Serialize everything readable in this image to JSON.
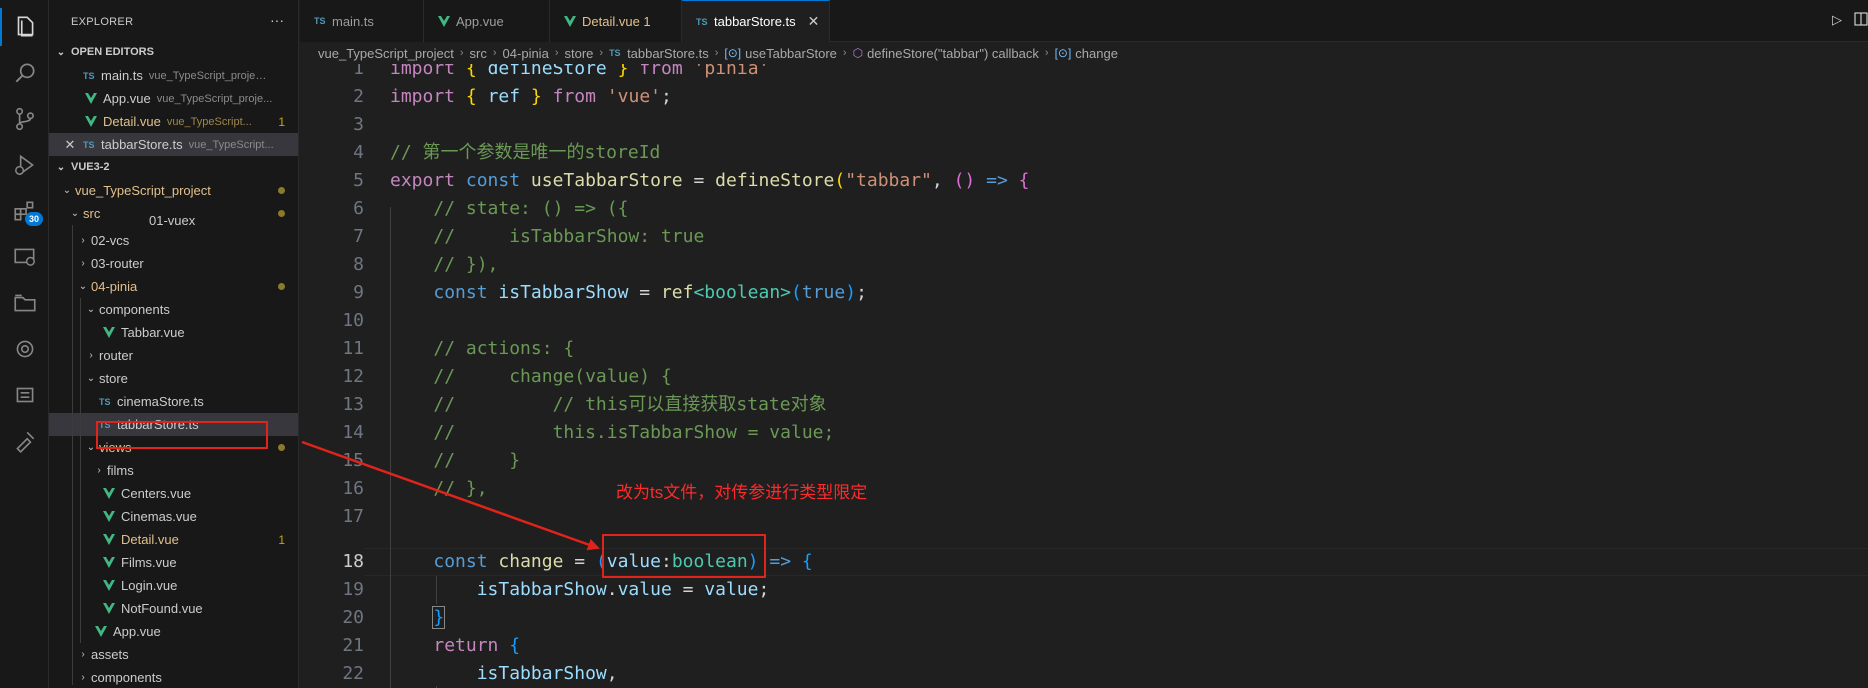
{
  "sidebar": {
    "title": "EXPLORER",
    "open_editors": {
      "header": "OPEN EDITORS",
      "items": [
        {
          "icon": "TS",
          "name": "main.ts",
          "desc": "vue_TypeScript_project..."
        },
        {
          "icon": "vue",
          "name": "App.vue",
          "desc": "vue_TypeScript_proje..."
        },
        {
          "icon": "vue",
          "name": "Detail.vue",
          "desc": "vue_TypeScript...",
          "count": "1"
        },
        {
          "icon": "TS",
          "name": "tabbarStore.ts",
          "desc": "vue_TypeScript..."
        }
      ]
    },
    "workspace": {
      "header": "VUE3-2",
      "project": "vue_TypeScript_project",
      "tree": [
        {
          "label": "src",
          "color": "orange"
        },
        {
          "label": "01-vuex"
        },
        {
          "label": "02-vcs"
        },
        {
          "label": "03-router"
        },
        {
          "label": "04-pinia"
        },
        {
          "label": "components"
        },
        {
          "label": "Tabbar.vue"
        },
        {
          "label": "router"
        },
        {
          "label": "store"
        },
        {
          "label": "cinemaStore.ts"
        },
        {
          "label": "tabbarStore.ts"
        },
        {
          "label": "views"
        },
        {
          "label": "films"
        },
        {
          "label": "Centers.vue"
        },
        {
          "label": "Cinemas.vue"
        },
        {
          "label": "Detail.vue",
          "count": "1"
        },
        {
          "label": "Films.vue"
        },
        {
          "label": "Login.vue"
        },
        {
          "label": "NotFound.vue"
        },
        {
          "label": "App.vue"
        },
        {
          "label": "assets"
        },
        {
          "label": "components"
        }
      ]
    }
  },
  "activity": {
    "extensions_badge": "30"
  },
  "tabs": [
    {
      "label": "main.ts",
      "icon": "TS"
    },
    {
      "label": "App.vue",
      "icon": "vue"
    },
    {
      "label": "Detail.vue 1",
      "icon": "vue"
    },
    {
      "label": "tabbarStore.ts",
      "icon": "TS",
      "active": true
    }
  ],
  "breadcrumb": [
    "vue_TypeScript_project",
    "src",
    "04-pinia",
    "store",
    "tabbarStore.ts",
    "useTabbarStore",
    "defineStore(\"tabbar\") callback",
    "change"
  ],
  "editor": {
    "line_numbers": [
      "1",
      "2",
      "3",
      "4",
      "5",
      "6",
      "7",
      "8",
      "9",
      "10",
      "11",
      "12",
      "13",
      "14",
      "15",
      "16",
      "17",
      "18",
      "19",
      "20",
      "21",
      "22"
    ],
    "current_line": "18"
  },
  "annotation": {
    "note": "改为ts文件，对传参进行类型限定",
    "color": "#e0231b"
  }
}
